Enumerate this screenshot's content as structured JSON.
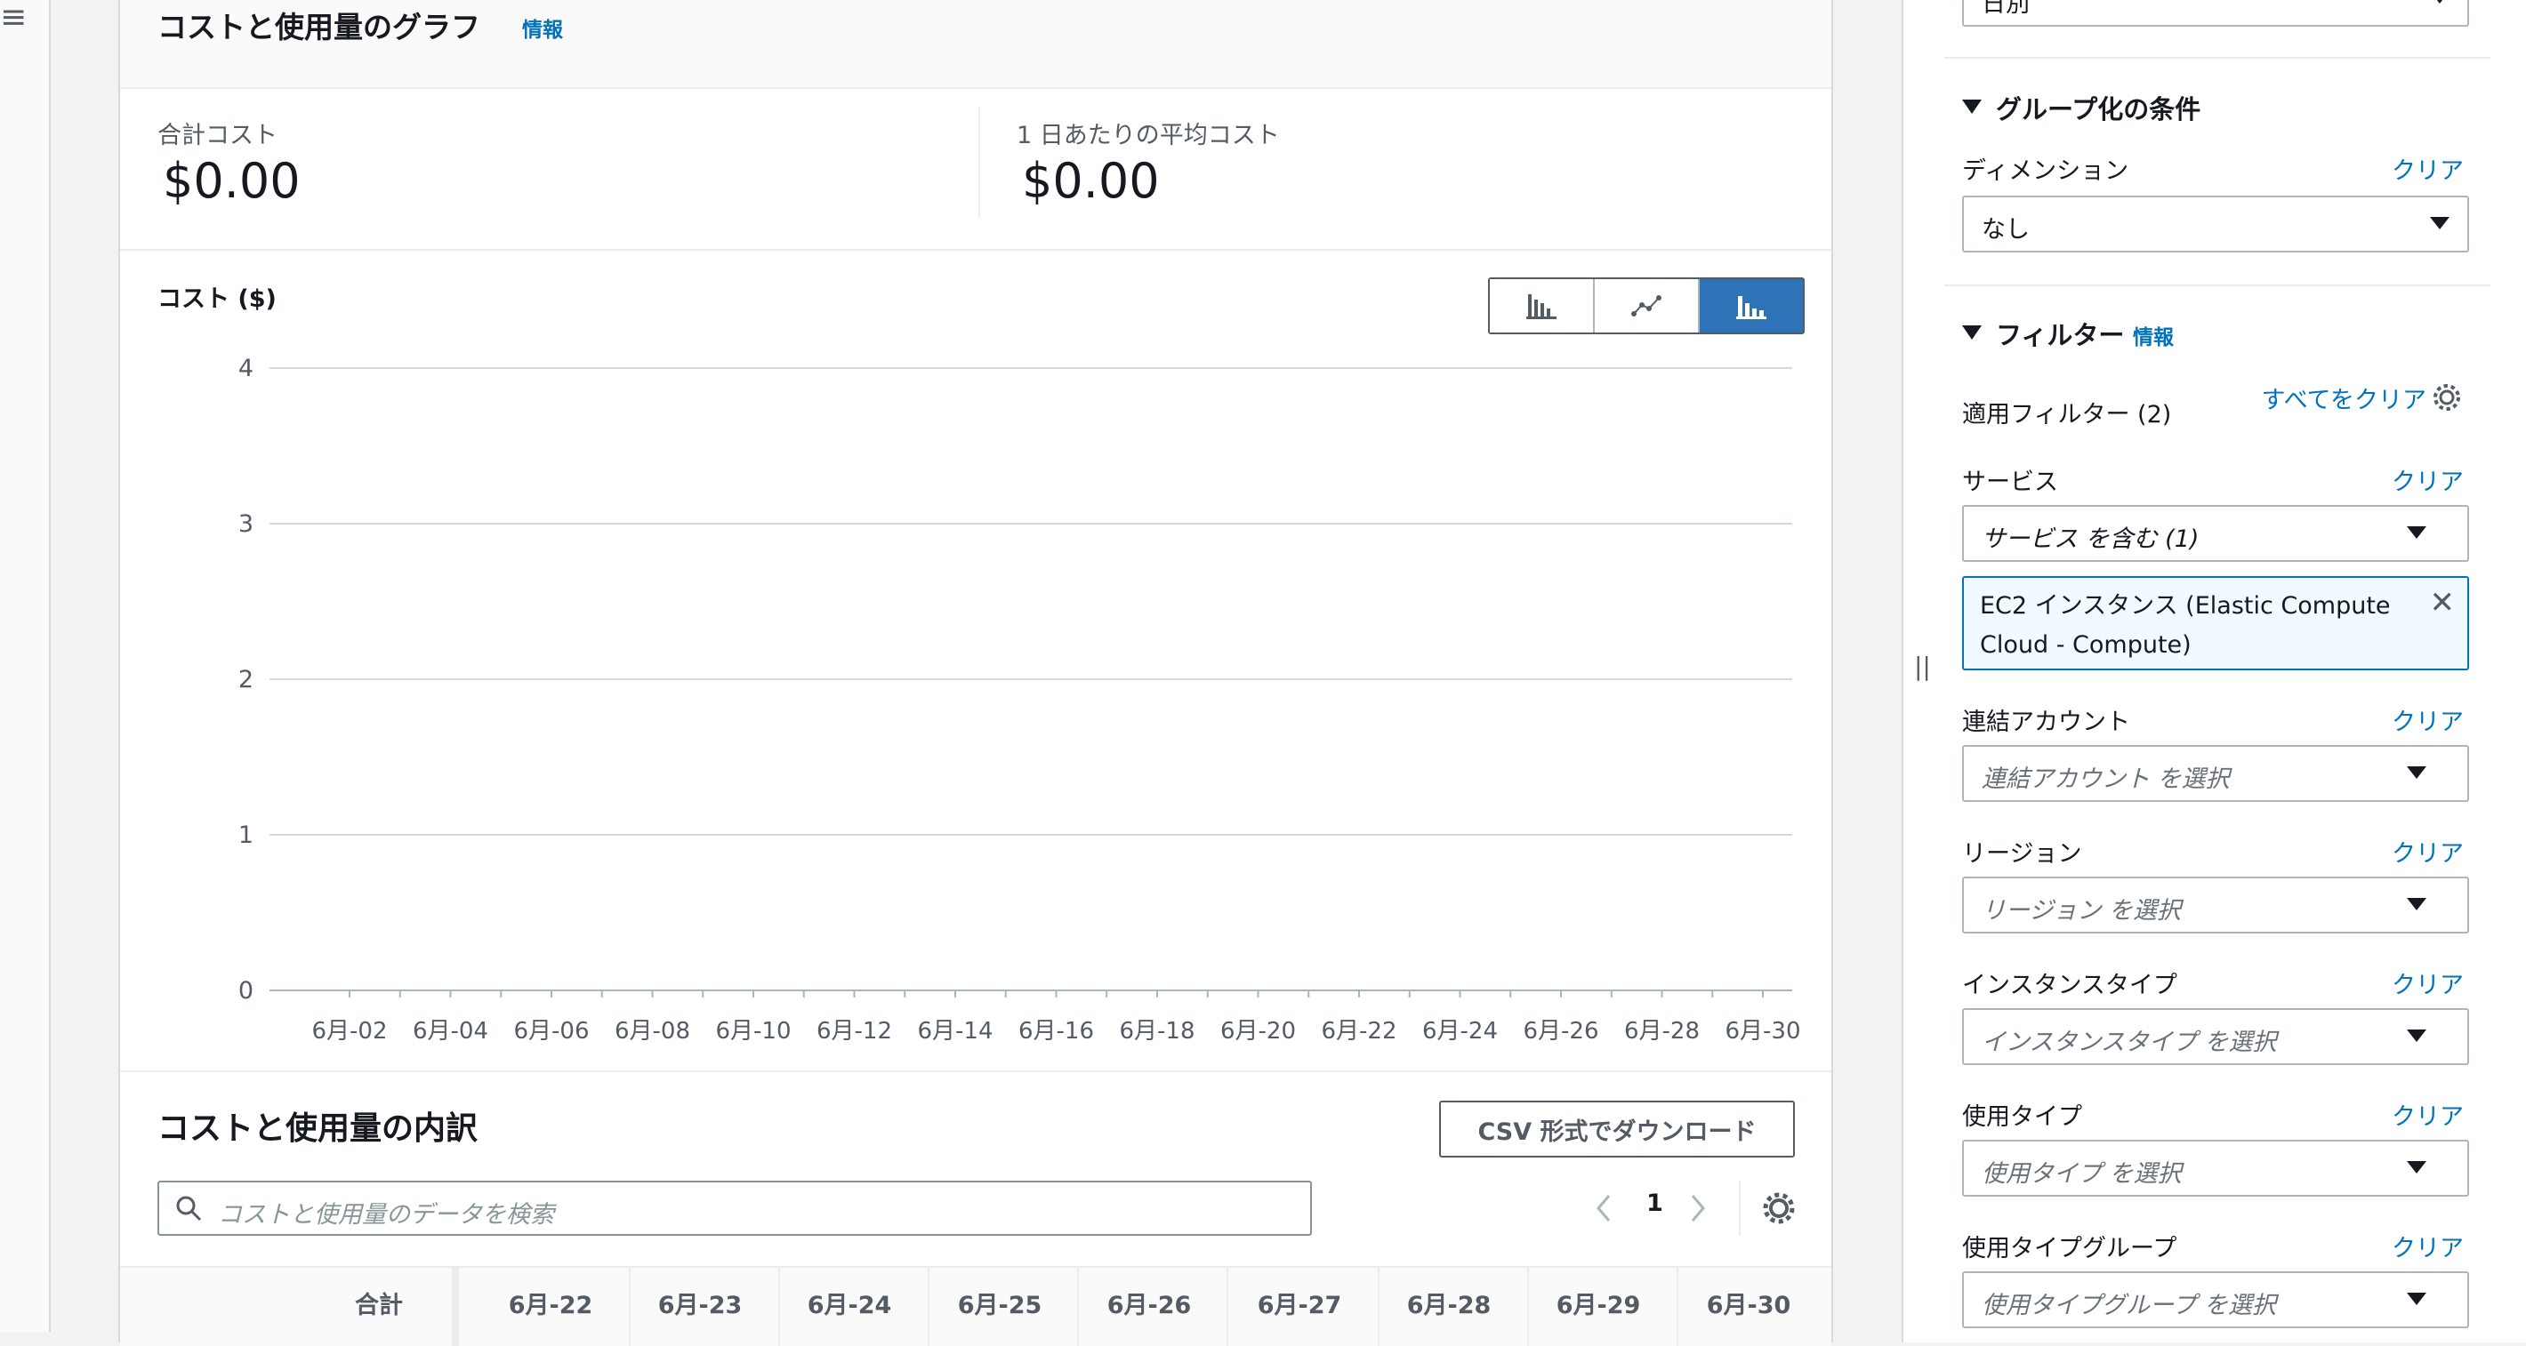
{
  "nav": {
    "menu_icon": "≡"
  },
  "graph": {
    "title": "コストと使用量のグラフ",
    "info": "情報",
    "total_cost_label": "合計コスト",
    "total_cost_value": "$0.00",
    "avg_cost_label": "1 日あたりの平均コスト",
    "avg_cost_value": "$0.00",
    "chart_toggle": {
      "options": [
        "bar-chart-icon",
        "line-chart-icon",
        "stacked-bar-chart-icon"
      ],
      "selected": "stacked-bar-chart-icon"
    }
  },
  "chart_data": {
    "type": "bar",
    "ylabel": "コスト ($)",
    "ylim": [
      0,
      4
    ],
    "yticks": [
      "0",
      "1",
      "2",
      "3",
      "4"
    ],
    "xticks": [
      "6月-02",
      "6月-04",
      "6月-06",
      "6月-08",
      "6月-10",
      "6月-12",
      "6月-14",
      "6月-16",
      "6月-18",
      "6月-20",
      "6月-22",
      "6月-24",
      "6月-26",
      "6月-28",
      "6月-30"
    ],
    "series": [],
    "grid": true,
    "accent": "#2e73b8"
  },
  "breakdown": {
    "title": "コストと使用量の内訳",
    "csv_button": "CSV 形式でダウンロード",
    "search_placeholder": "コストと使用量のデータを検索",
    "page": "1",
    "columns": [
      "合計",
      "6月-22",
      "6月-23",
      "6月-24",
      "6月-25",
      "6月-26",
      "6月-27",
      "6月-28",
      "6月-29",
      "6月-30"
    ]
  },
  "sidebar": {
    "top_select_value": "日別",
    "group_by": {
      "title": "グループ化の条件",
      "dimension_label": "ディメンション",
      "clear": "クリア",
      "dimension_value": "なし"
    },
    "filters": {
      "title": "フィルター",
      "info": "情報",
      "applied": "適用フィルター (2)",
      "clear_all": "すべてをクリア",
      "service": {
        "label": "サービス",
        "clear": "クリア",
        "value": "サービス を含む (1)",
        "token": "EC2 インスタンス (Elastic Compute Cloud - Compute)"
      },
      "items": [
        {
          "label": "連結アカウント",
          "clear": "クリア",
          "placeholder": "連結アカウント を選択"
        },
        {
          "label": "リージョン",
          "clear": "クリア",
          "placeholder": "リージョン を選択"
        },
        {
          "label": "インスタンスタイプ",
          "clear": "クリア",
          "placeholder": "インスタンスタイプ を選択"
        },
        {
          "label": "使用タイプ",
          "clear": "クリア",
          "placeholder": "使用タイプ を選択"
        },
        {
          "label": "使用タイプグループ",
          "clear": "クリア",
          "placeholder": "使用タイプグループ を選択"
        }
      ]
    }
  }
}
